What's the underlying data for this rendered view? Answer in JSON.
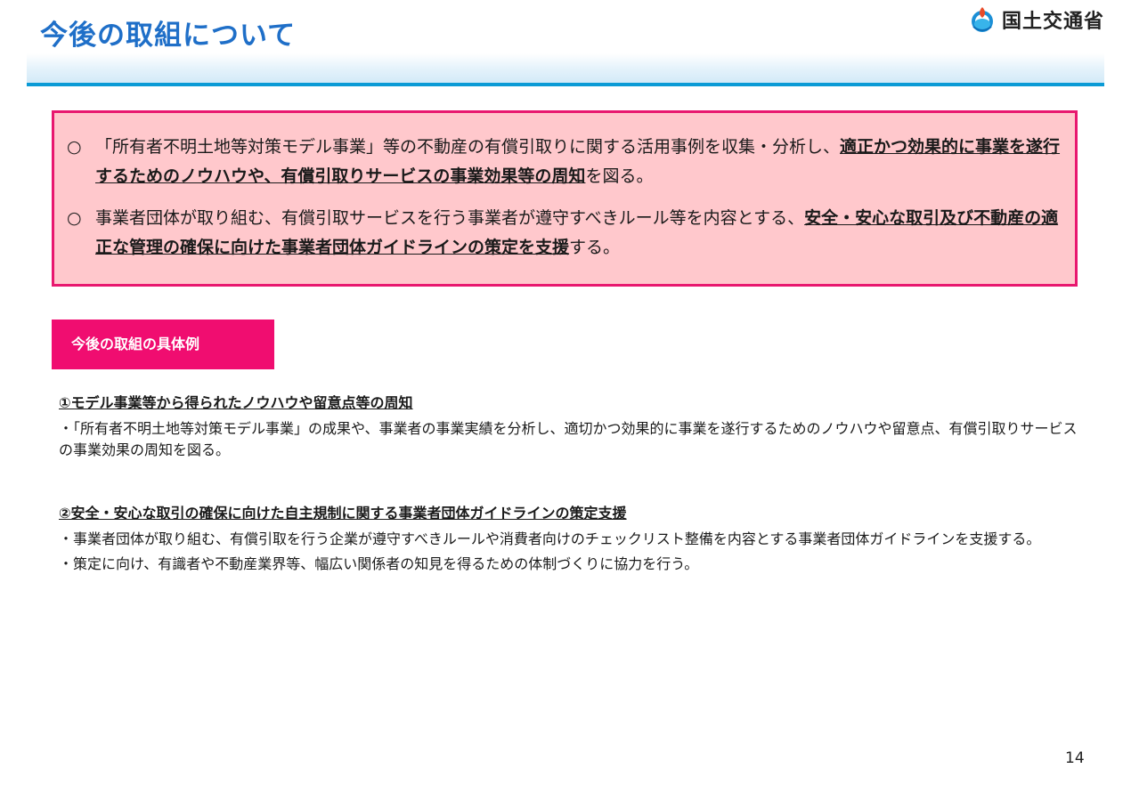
{
  "header": {
    "title": "今後の取組について",
    "logo_text": "国土交通省",
    "logo_icon": "mlit-logo-icon"
  },
  "summary": {
    "bullet": "○",
    "items": [
      {
        "text_before": "「所有者不明土地等対策モデル事業」等の不動産の有償引取りに関する活用事例を収集・分析し、",
        "emphasis": "適正かつ効果的に事業を遂行するためのノウハウや、有償引取りサービスの事業効果等の周知",
        "text_after": "を図る。"
      },
      {
        "text_before": "事業者団体が取り組む、有償引取サービスを行う事業者が遵守すべきルール等を内容とする、",
        "emphasis": "安全・安心な取引及び不動産の適正な管理の確保に向けた事業者団体ガイドラインの策定を支援",
        "text_after": "する。"
      }
    ]
  },
  "section_label": "今後の取組の具体例",
  "examples": [
    {
      "heading": "①モデル事業等から得られたノウハウや留意点等の周知",
      "lines": [
        "・「所有者不明土地等対策モデル事業」の成果や、事業者の事業実績を分析し、適切かつ効果的に事業を遂行するためのノウハウや留意点、有償引取りサービスの事業効果の周知を図る。"
      ]
    },
    {
      "heading": "②安全・安心な取引の確保に向けた自主規制に関する事業者団体ガイドラインの策定支援",
      "lines": [
        "・事業者団体が取り組む、有償引取を行う企業が遵守すべきルールや消費者向けのチェックリスト整備を内容とする事業者団体ガイドラインを支援する。",
        "・策定に向け、有識者や不動産業界等、幅広い関係者の知見を得るための体制づくりに協力を行う。"
      ]
    }
  ],
  "page_number": "14",
  "colors": {
    "title": "#1f6fc8",
    "header_line": "#0b9bd6",
    "box_border": "#e8186f",
    "box_fill": "#ffc8cc",
    "label_fill": "#f00d70"
  }
}
